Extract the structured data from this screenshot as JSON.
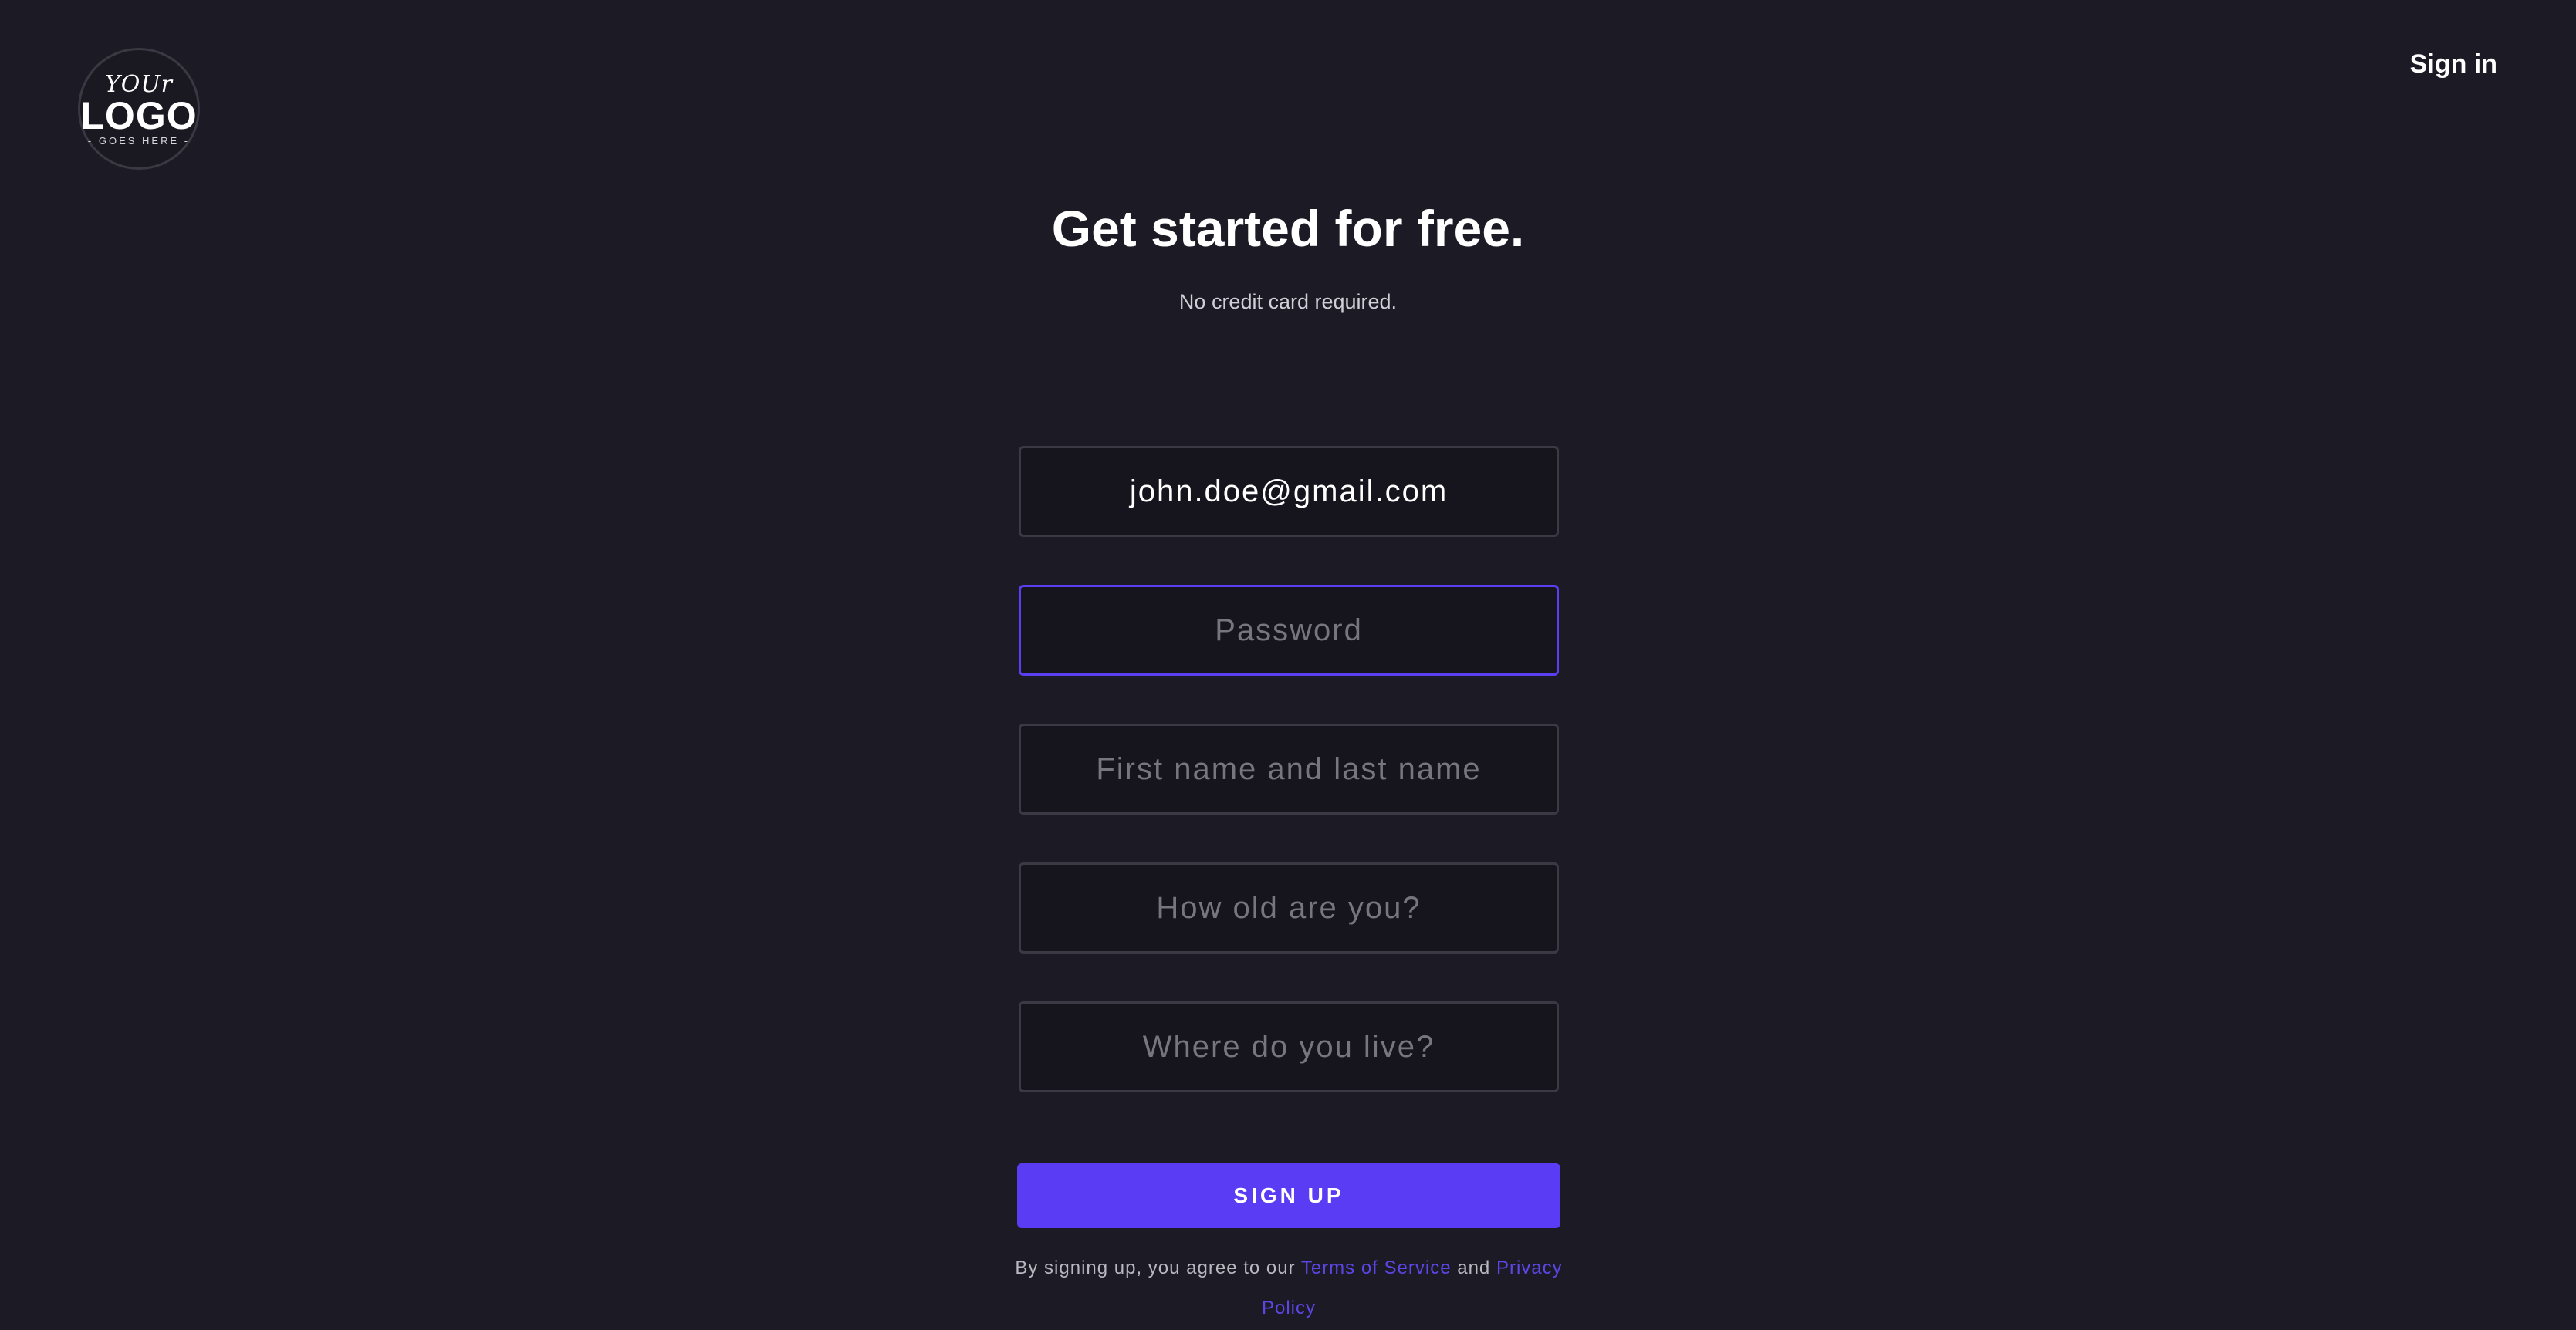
{
  "header": {
    "logo": {
      "top": "YOUr",
      "main": "LOGO",
      "bottom": "- GOES HERE -"
    },
    "signin_label": "Sign in"
  },
  "hero": {
    "title": "Get started for free.",
    "subtitle": "No credit card required."
  },
  "form": {
    "email": {
      "value": "john.doe@gmail.com",
      "placeholder": ""
    },
    "password": {
      "value": "",
      "placeholder": "Password"
    },
    "name": {
      "value": "",
      "placeholder": "First name and last name"
    },
    "age": {
      "value": "",
      "placeholder": "How old are you?"
    },
    "location": {
      "value": "",
      "placeholder": "Where do you live?"
    },
    "submit_label": "SIGN UP"
  },
  "legal": {
    "prefix": "By signing up, you agree to our ",
    "terms_label": "Terms of Service",
    "conjunction": " and ",
    "privacy_label": "Privacy Policy"
  },
  "colors": {
    "background": "#1c1a24",
    "accent": "#5b3cf5",
    "link": "#5b46e8",
    "field_border": "#3b3944",
    "field_focus_border": "#5a3ff0"
  }
}
